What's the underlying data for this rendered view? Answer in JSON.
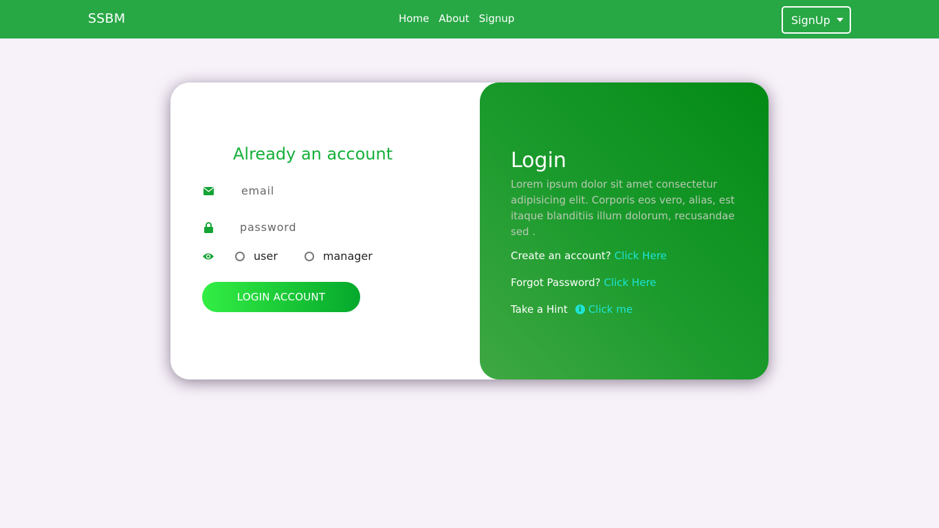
{
  "navbar": {
    "brand": "SSBM",
    "links": [
      "Home",
      "About",
      "Signup"
    ],
    "dropdown_label": "SignUp"
  },
  "login_form": {
    "title": "Already an account",
    "email_placeholder": "email",
    "password_placeholder": "password",
    "role_options": [
      "user",
      "manager"
    ],
    "submit_label": "LOGIN ACCOUNT"
  },
  "info_panel": {
    "title": "Login",
    "description": "Lorem ipsum dolor sit amet consectetur adipisicing elit. Corporis eos vero, alias, est itaque blanditiis illum dolorum, recusandae sed .",
    "create_account_text": "Create an account?",
    "create_account_link": "Click Here",
    "forgot_password_text": "Forgot Password?",
    "forgot_password_link": "Click Here",
    "hint_text": "Take a Hint",
    "hint_link": "Click me"
  },
  "icons": {
    "email": "envelope-icon",
    "password": "lock-icon",
    "role": "eye-icon",
    "hint": "info-icon",
    "dropdown": "caret-down-icon"
  },
  "colors": {
    "navbar": "#28a745",
    "accent_green": "#14b03a",
    "link_cyan": "#1ee4d6",
    "page_bg": "#f7f1f9"
  }
}
